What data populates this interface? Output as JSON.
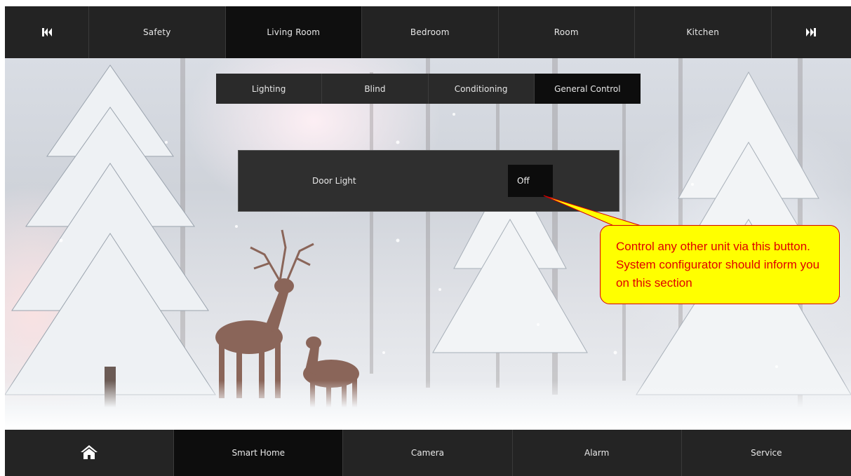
{
  "top_nav": {
    "prev_icon": "skip-previous-icon",
    "next_icon": "skip-next-icon",
    "tabs": [
      {
        "label": "Safety",
        "active": false
      },
      {
        "label": "Living Room",
        "active": true
      },
      {
        "label": "Bedroom",
        "active": false
      },
      {
        "label": "Room",
        "active": false
      },
      {
        "label": "Kitchen",
        "active": false
      }
    ]
  },
  "sub_tabs": [
    {
      "label": "Lighting",
      "active": false
    },
    {
      "label": "Blind",
      "active": false
    },
    {
      "label": "Conditioning",
      "active": false
    },
    {
      "label": "General Control",
      "active": true
    }
  ],
  "control_panel": {
    "item_label": "Door Light",
    "toggle_value": "Off"
  },
  "callout": {
    "text": "Control any other unit via this button. System configurator should inform you on this section",
    "fill_color": "#ffff00",
    "text_color": "#e00000"
  },
  "bottom_nav": {
    "home_icon": "home-icon",
    "items": [
      {
        "label": "Smart Home",
        "active": true
      },
      {
        "label": "Camera",
        "active": false
      },
      {
        "label": "Alarm",
        "active": false
      },
      {
        "label": "Service",
        "active": false
      }
    ]
  },
  "colors": {
    "nav_bg": "#232323",
    "nav_active": "#0f0f0f"
  }
}
